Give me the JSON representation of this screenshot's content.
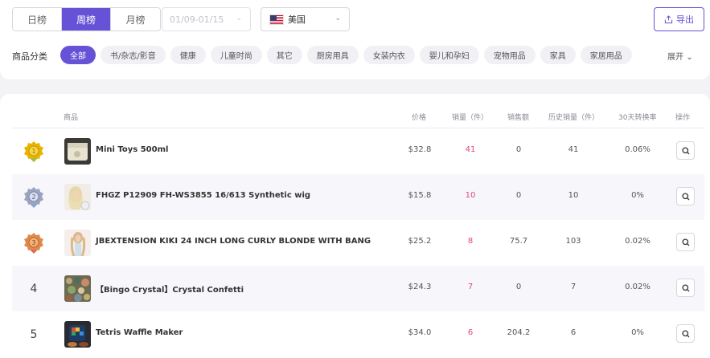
{
  "tabs": [
    {
      "label": "日榜",
      "active": false
    },
    {
      "label": "周榜",
      "active": true
    },
    {
      "label": "月榜",
      "active": false
    }
  ],
  "date_range": {
    "placeholder": "01/09-01/15"
  },
  "region": {
    "label": "美国",
    "icon": "us-flag-icon"
  },
  "export_label": "导出",
  "category": {
    "label": "商品分类",
    "items": [
      "全部",
      "书/杂志/影音",
      "健康",
      "儿童时尚",
      "其它",
      "厨房用具",
      "女装内衣",
      "婴儿和孕妇",
      "宠物用品",
      "家具",
      "家居用品"
    ],
    "expand_label": "展开"
  },
  "table": {
    "headers": {
      "product": "商品",
      "price": "价格",
      "sales": "销量（件）",
      "revenue": "销售额",
      "history": "历史销量（件）",
      "conversion": "30天转换率",
      "action": "操作"
    },
    "rows": [
      {
        "rank": "1",
        "name": "Mini Toys 500ml",
        "price": "$32.8",
        "sales": "41",
        "revenue": "0",
        "history": "41",
        "conversion": "0.06%",
        "medal": "gold"
      },
      {
        "rank": "2",
        "name": "FHGZ P12909 FH-WS3855 16/613 Synthetic wig",
        "price": "$15.8",
        "sales": "10",
        "revenue": "0",
        "history": "10",
        "conversion": "0%",
        "medal": "silver"
      },
      {
        "rank": "3",
        "name": "JBEXTENSION KIKI 24 INCH LONG CURLY BLONDE WITH BANG",
        "price": "$25.2",
        "sales": "8",
        "revenue": "75.7",
        "history": "103",
        "conversion": "0.02%",
        "medal": "bronze"
      },
      {
        "rank": "4",
        "name": "【Bingo Crystal】Crystal Confetti",
        "price": "$24.3",
        "sales": "7",
        "revenue": "0",
        "history": "7",
        "conversion": "0.02%",
        "medal": ""
      },
      {
        "rank": "5",
        "name": "Tetris Waffle Maker",
        "price": "$34.0",
        "sales": "6",
        "revenue": "204.2",
        "history": "6",
        "conversion": "0%",
        "medal": ""
      }
    ]
  },
  "colors": {
    "accent": "#6552d6",
    "sales": "#e0457b",
    "gold": "#e0a800",
    "silver": "#9aa3c0",
    "bronze": "#e08a4a"
  }
}
